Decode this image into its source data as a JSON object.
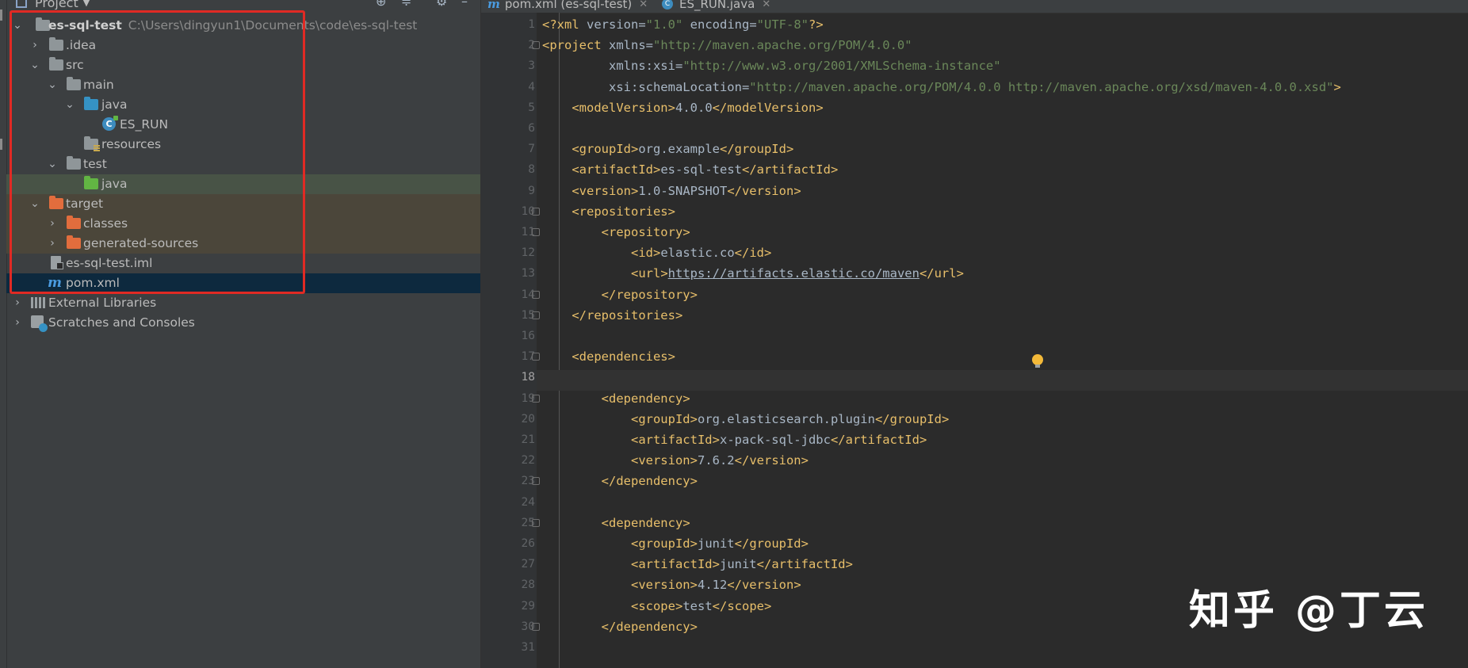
{
  "project_panel": {
    "title": "Project",
    "tree": [
      {
        "label": "es-sql-test",
        "path": "C:\\Users\\dingyun1\\Documents\\code\\es-sql-test",
        "icon": "module-folder-icon"
      },
      {
        "label": ".idea",
        "icon": "folder-icon"
      },
      {
        "label": "src",
        "icon": "folder-icon"
      },
      {
        "label": "main",
        "icon": "folder-icon"
      },
      {
        "label": "java",
        "icon": "source-folder-icon"
      },
      {
        "label": "ES_RUN",
        "icon": "java-class-icon"
      },
      {
        "label": "resources",
        "icon": "resources-folder-icon"
      },
      {
        "label": "test",
        "icon": "folder-icon"
      },
      {
        "label": "java",
        "icon": "test-folder-icon"
      },
      {
        "label": "target",
        "icon": "excluded-folder-icon"
      },
      {
        "label": "classes",
        "icon": "excluded-folder-icon"
      },
      {
        "label": "generated-sources",
        "icon": "excluded-folder-icon"
      },
      {
        "label": "es-sql-test.iml",
        "icon": "iml-file-icon"
      },
      {
        "label": "pom.xml",
        "icon": "maven-icon"
      },
      {
        "label": "External Libraries",
        "icon": "libraries-icon"
      },
      {
        "label": "Scratches and Consoles",
        "icon": "scratches-icon"
      }
    ]
  },
  "tabs": [
    {
      "label": "pom.xml (es-sql-test)",
      "icon": "maven-icon",
      "active": true
    },
    {
      "label": "ES_RUN.java",
      "icon": "java-class-icon",
      "active": false
    }
  ],
  "editor": {
    "current_line": 18,
    "lines": [
      "<?xml version=\"1.0\" encoding=\"UTF-8\"?>",
      "<project xmlns=\"http://maven.apache.org/POM/4.0.0\"",
      "         xmlns:xsi=\"http://www.w3.org/2001/XMLSchema-instance\"",
      "         xsi:schemaLocation=\"http://maven.apache.org/POM/4.0.0 http://maven.apache.org/xsd/maven-4.0.0.xsd\">",
      "    <modelVersion>4.0.0</modelVersion>",
      "",
      "    <groupId>org.example</groupId>",
      "    <artifactId>es-sql-test</artifactId>",
      "    <version>1.0-SNAPSHOT</version>",
      "    <repositories>",
      "        <repository>",
      "            <id>elastic.co</id>",
      "            <url>https://artifacts.elastic.co/maven</url>",
      "        </repository>",
      "    </repositories>",
      "",
      "    <dependencies>",
      "",
      "        <dependency>",
      "            <groupId>org.elasticsearch.plugin</groupId>",
      "            <artifactId>x-pack-sql-jdbc</artifactId>",
      "            <version>7.6.2</version>",
      "        </dependency>",
      "",
      "        <dependency>",
      "            <groupId>junit</groupId>",
      "            <artifactId>junit</artifactId>",
      "            <version>4.12</version>",
      "            <scope>test</scope>",
      "        </dependency>",
      ""
    ]
  },
  "watermark": "知乎 @丁云",
  "colors": {
    "highlight_box": "#e02a24",
    "tag": "#e8bf6a",
    "attr_value": "#6a8759",
    "namespace": "#9876aa",
    "text": "#a9b7c6"
  }
}
